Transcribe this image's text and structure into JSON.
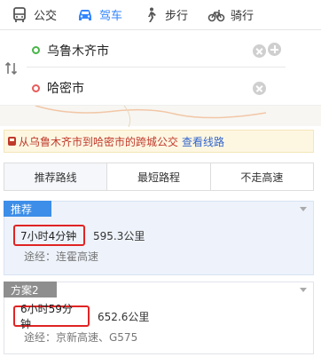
{
  "modes": [
    {
      "label": "公交",
      "icon": "bus-icon"
    },
    {
      "label": "驾车",
      "icon": "car-icon",
      "active": true
    },
    {
      "label": "步行",
      "icon": "walk-icon"
    },
    {
      "label": "骑行",
      "icon": "bike-icon"
    }
  ],
  "route": {
    "start": "乌鲁木齐市",
    "end": "哈密市"
  },
  "notice": {
    "text": "从乌鲁木齐市到哈密市的跨城公交",
    "link": "查看线路"
  },
  "tabs": [
    "推荐路线",
    "最短路程",
    "不走高速"
  ],
  "plans": [
    {
      "tag": "推荐",
      "time": "7小时4分钟",
      "distance": "595.3公里",
      "via": "途经：连霍高速"
    },
    {
      "tag": "方案2",
      "time": "6小时59分钟",
      "distance": "652.6公里",
      "via": "途经：京新高速、G575"
    }
  ],
  "colors": {
    "accent": "#3385ff",
    "highlight": "#e02424",
    "notice_text": "#c0392b",
    "link": "#3366cc"
  }
}
